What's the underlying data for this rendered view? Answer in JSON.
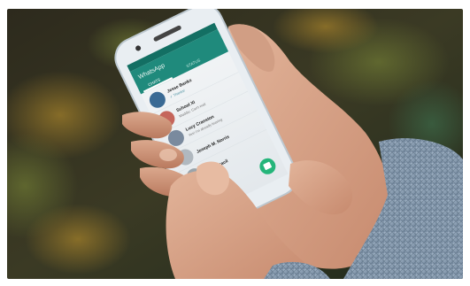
{
  "phone_screen": {
    "app_title": "WhatsApp",
    "tab_chats": "CHATS",
    "tab_status": "STATUS",
    "chats": [
      {
        "name": "Jesse Banks",
        "preview": "✓ Thanks!"
      },
      {
        "name": "School XI",
        "preview": "Maddie: Can't wait"
      },
      {
        "name": "Lucy Cranston",
        "preview": "Yes! I'm already leaving"
      },
      {
        "name": "Joseph M. Norris",
        "preview": ""
      },
      {
        "name": "…ael Bracil",
        "preview": ""
      }
    ]
  },
  "colors": {
    "whatsapp_teal": "#1f8a7c",
    "fab_green": "#25b57a",
    "sweater_blue": "#8aa1b6",
    "phone_white": "#e9eef2"
  }
}
